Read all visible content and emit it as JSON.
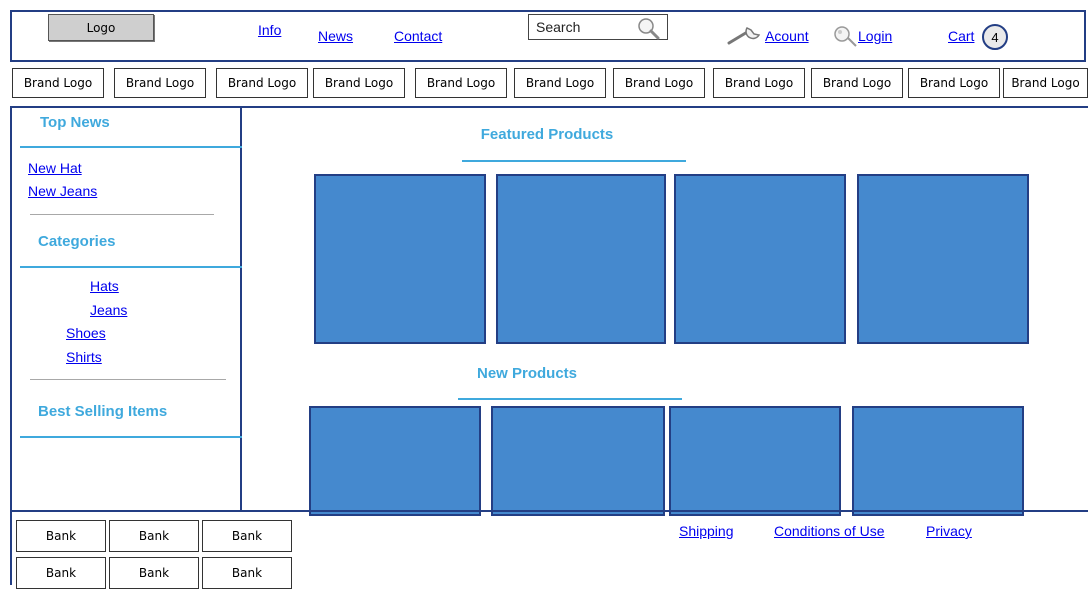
{
  "header": {
    "logo": "Logo",
    "nav": [
      "Info",
      "News",
      "Contact"
    ],
    "search_placeholder": "Search",
    "account": "Acount",
    "login": "Login",
    "cart": "Cart",
    "cart_count": "4"
  },
  "brands": [
    "Brand Logo",
    "Brand Logo",
    "Brand Logo",
    "Brand Logo",
    "Brand Logo",
    "Brand Logo",
    "Brand Logo",
    "Brand Logo",
    "Brand Logo",
    "Brand Logo",
    "Brand Logo"
  ],
  "sidebar": {
    "top_news": {
      "title": "Top News",
      "links": [
        "New Hat",
        "New Jeans"
      ]
    },
    "categories": {
      "title": "Categories",
      "links": [
        "Hats",
        "Jeans",
        "Shoes",
        "Shirts"
      ]
    },
    "best_selling": {
      "title": "Best Selling Items"
    }
  },
  "main": {
    "featured_title": "Featured Products",
    "new_title": "New Products"
  },
  "footer": {
    "banks": [
      "Bank",
      "Bank",
      "Bank",
      "Bank",
      "Bank",
      "Bank"
    ],
    "links": [
      "Shipping",
      "Conditions of Use",
      "Privacy"
    ]
  },
  "colors": {
    "accent": "#3fa9dd",
    "border": "#233e84",
    "product": "#4589ce"
  }
}
